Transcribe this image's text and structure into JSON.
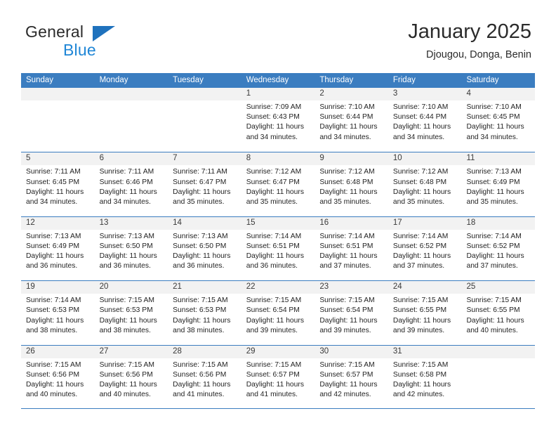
{
  "brand": {
    "name_top": "General",
    "name_bottom": "Blue",
    "triangle_color": "#1f72bd",
    "blue_color": "#1f86d6"
  },
  "header": {
    "title": "January 2025",
    "subtitle": "Djougou, Donga, Benin"
  },
  "theme": {
    "header_blue": "#3b7dc0",
    "day_band_gray": "#f2f2f2",
    "text": "#232323"
  },
  "weekdays": [
    "Sunday",
    "Monday",
    "Tuesday",
    "Wednesday",
    "Thursday",
    "Friday",
    "Saturday"
  ],
  "labels": {
    "sunrise_prefix": "Sunrise:",
    "sunset_prefix": "Sunset:",
    "daylight_prefix": "Daylight:"
  },
  "weeks": [
    [
      {
        "day": "",
        "empty": true
      },
      {
        "day": "",
        "empty": true
      },
      {
        "day": "",
        "empty": true
      },
      {
        "day": "1",
        "sunrise": "Sunrise: 7:09 AM",
        "sunset": "Sunset: 6:43 PM",
        "daylight1": "Daylight: 11 hours",
        "daylight2": "and 34 minutes."
      },
      {
        "day": "2",
        "sunrise": "Sunrise: 7:10 AM",
        "sunset": "Sunset: 6:44 PM",
        "daylight1": "Daylight: 11 hours",
        "daylight2": "and 34 minutes."
      },
      {
        "day": "3",
        "sunrise": "Sunrise: 7:10 AM",
        "sunset": "Sunset: 6:44 PM",
        "daylight1": "Daylight: 11 hours",
        "daylight2": "and 34 minutes."
      },
      {
        "day": "4",
        "sunrise": "Sunrise: 7:10 AM",
        "sunset": "Sunset: 6:45 PM",
        "daylight1": "Daylight: 11 hours",
        "daylight2": "and 34 minutes."
      }
    ],
    [
      {
        "day": "5",
        "sunrise": "Sunrise: 7:11 AM",
        "sunset": "Sunset: 6:45 PM",
        "daylight1": "Daylight: 11 hours",
        "daylight2": "and 34 minutes."
      },
      {
        "day": "6",
        "sunrise": "Sunrise: 7:11 AM",
        "sunset": "Sunset: 6:46 PM",
        "daylight1": "Daylight: 11 hours",
        "daylight2": "and 34 minutes."
      },
      {
        "day": "7",
        "sunrise": "Sunrise: 7:11 AM",
        "sunset": "Sunset: 6:47 PM",
        "daylight1": "Daylight: 11 hours",
        "daylight2": "and 35 minutes."
      },
      {
        "day": "8",
        "sunrise": "Sunrise: 7:12 AM",
        "sunset": "Sunset: 6:47 PM",
        "daylight1": "Daylight: 11 hours",
        "daylight2": "and 35 minutes."
      },
      {
        "day": "9",
        "sunrise": "Sunrise: 7:12 AM",
        "sunset": "Sunset: 6:48 PM",
        "daylight1": "Daylight: 11 hours",
        "daylight2": "and 35 minutes."
      },
      {
        "day": "10",
        "sunrise": "Sunrise: 7:12 AM",
        "sunset": "Sunset: 6:48 PM",
        "daylight1": "Daylight: 11 hours",
        "daylight2": "and 35 minutes."
      },
      {
        "day": "11",
        "sunrise": "Sunrise: 7:13 AM",
        "sunset": "Sunset: 6:49 PM",
        "daylight1": "Daylight: 11 hours",
        "daylight2": "and 35 minutes."
      }
    ],
    [
      {
        "day": "12",
        "sunrise": "Sunrise: 7:13 AM",
        "sunset": "Sunset: 6:49 PM",
        "daylight1": "Daylight: 11 hours",
        "daylight2": "and 36 minutes."
      },
      {
        "day": "13",
        "sunrise": "Sunrise: 7:13 AM",
        "sunset": "Sunset: 6:50 PM",
        "daylight1": "Daylight: 11 hours",
        "daylight2": "and 36 minutes."
      },
      {
        "day": "14",
        "sunrise": "Sunrise: 7:13 AM",
        "sunset": "Sunset: 6:50 PM",
        "daylight1": "Daylight: 11 hours",
        "daylight2": "and 36 minutes."
      },
      {
        "day": "15",
        "sunrise": "Sunrise: 7:14 AM",
        "sunset": "Sunset: 6:51 PM",
        "daylight1": "Daylight: 11 hours",
        "daylight2": "and 36 minutes."
      },
      {
        "day": "16",
        "sunrise": "Sunrise: 7:14 AM",
        "sunset": "Sunset: 6:51 PM",
        "daylight1": "Daylight: 11 hours",
        "daylight2": "and 37 minutes."
      },
      {
        "day": "17",
        "sunrise": "Sunrise: 7:14 AM",
        "sunset": "Sunset: 6:52 PM",
        "daylight1": "Daylight: 11 hours",
        "daylight2": "and 37 minutes."
      },
      {
        "day": "18",
        "sunrise": "Sunrise: 7:14 AM",
        "sunset": "Sunset: 6:52 PM",
        "daylight1": "Daylight: 11 hours",
        "daylight2": "and 37 minutes."
      }
    ],
    [
      {
        "day": "19",
        "sunrise": "Sunrise: 7:14 AM",
        "sunset": "Sunset: 6:53 PM",
        "daylight1": "Daylight: 11 hours",
        "daylight2": "and 38 minutes."
      },
      {
        "day": "20",
        "sunrise": "Sunrise: 7:15 AM",
        "sunset": "Sunset: 6:53 PM",
        "daylight1": "Daylight: 11 hours",
        "daylight2": "and 38 minutes."
      },
      {
        "day": "21",
        "sunrise": "Sunrise: 7:15 AM",
        "sunset": "Sunset: 6:53 PM",
        "daylight1": "Daylight: 11 hours",
        "daylight2": "and 38 minutes."
      },
      {
        "day": "22",
        "sunrise": "Sunrise: 7:15 AM",
        "sunset": "Sunset: 6:54 PM",
        "daylight1": "Daylight: 11 hours",
        "daylight2": "and 39 minutes."
      },
      {
        "day": "23",
        "sunrise": "Sunrise: 7:15 AM",
        "sunset": "Sunset: 6:54 PM",
        "daylight1": "Daylight: 11 hours",
        "daylight2": "and 39 minutes."
      },
      {
        "day": "24",
        "sunrise": "Sunrise: 7:15 AM",
        "sunset": "Sunset: 6:55 PM",
        "daylight1": "Daylight: 11 hours",
        "daylight2": "and 39 minutes."
      },
      {
        "day": "25",
        "sunrise": "Sunrise: 7:15 AM",
        "sunset": "Sunset: 6:55 PM",
        "daylight1": "Daylight: 11 hours",
        "daylight2": "and 40 minutes."
      }
    ],
    [
      {
        "day": "26",
        "sunrise": "Sunrise: 7:15 AM",
        "sunset": "Sunset: 6:56 PM",
        "daylight1": "Daylight: 11 hours",
        "daylight2": "and 40 minutes."
      },
      {
        "day": "27",
        "sunrise": "Sunrise: 7:15 AM",
        "sunset": "Sunset: 6:56 PM",
        "daylight1": "Daylight: 11 hours",
        "daylight2": "and 40 minutes."
      },
      {
        "day": "28",
        "sunrise": "Sunrise: 7:15 AM",
        "sunset": "Sunset: 6:56 PM",
        "daylight1": "Daylight: 11 hours",
        "daylight2": "and 41 minutes."
      },
      {
        "day": "29",
        "sunrise": "Sunrise: 7:15 AM",
        "sunset": "Sunset: 6:57 PM",
        "daylight1": "Daylight: 11 hours",
        "daylight2": "and 41 minutes."
      },
      {
        "day": "30",
        "sunrise": "Sunrise: 7:15 AM",
        "sunset": "Sunset: 6:57 PM",
        "daylight1": "Daylight: 11 hours",
        "daylight2": "and 42 minutes."
      },
      {
        "day": "31",
        "sunrise": "Sunrise: 7:15 AM",
        "sunset": "Sunset: 6:58 PM",
        "daylight1": "Daylight: 11 hours",
        "daylight2": "and 42 minutes."
      },
      {
        "day": "",
        "empty": true
      }
    ]
  ]
}
